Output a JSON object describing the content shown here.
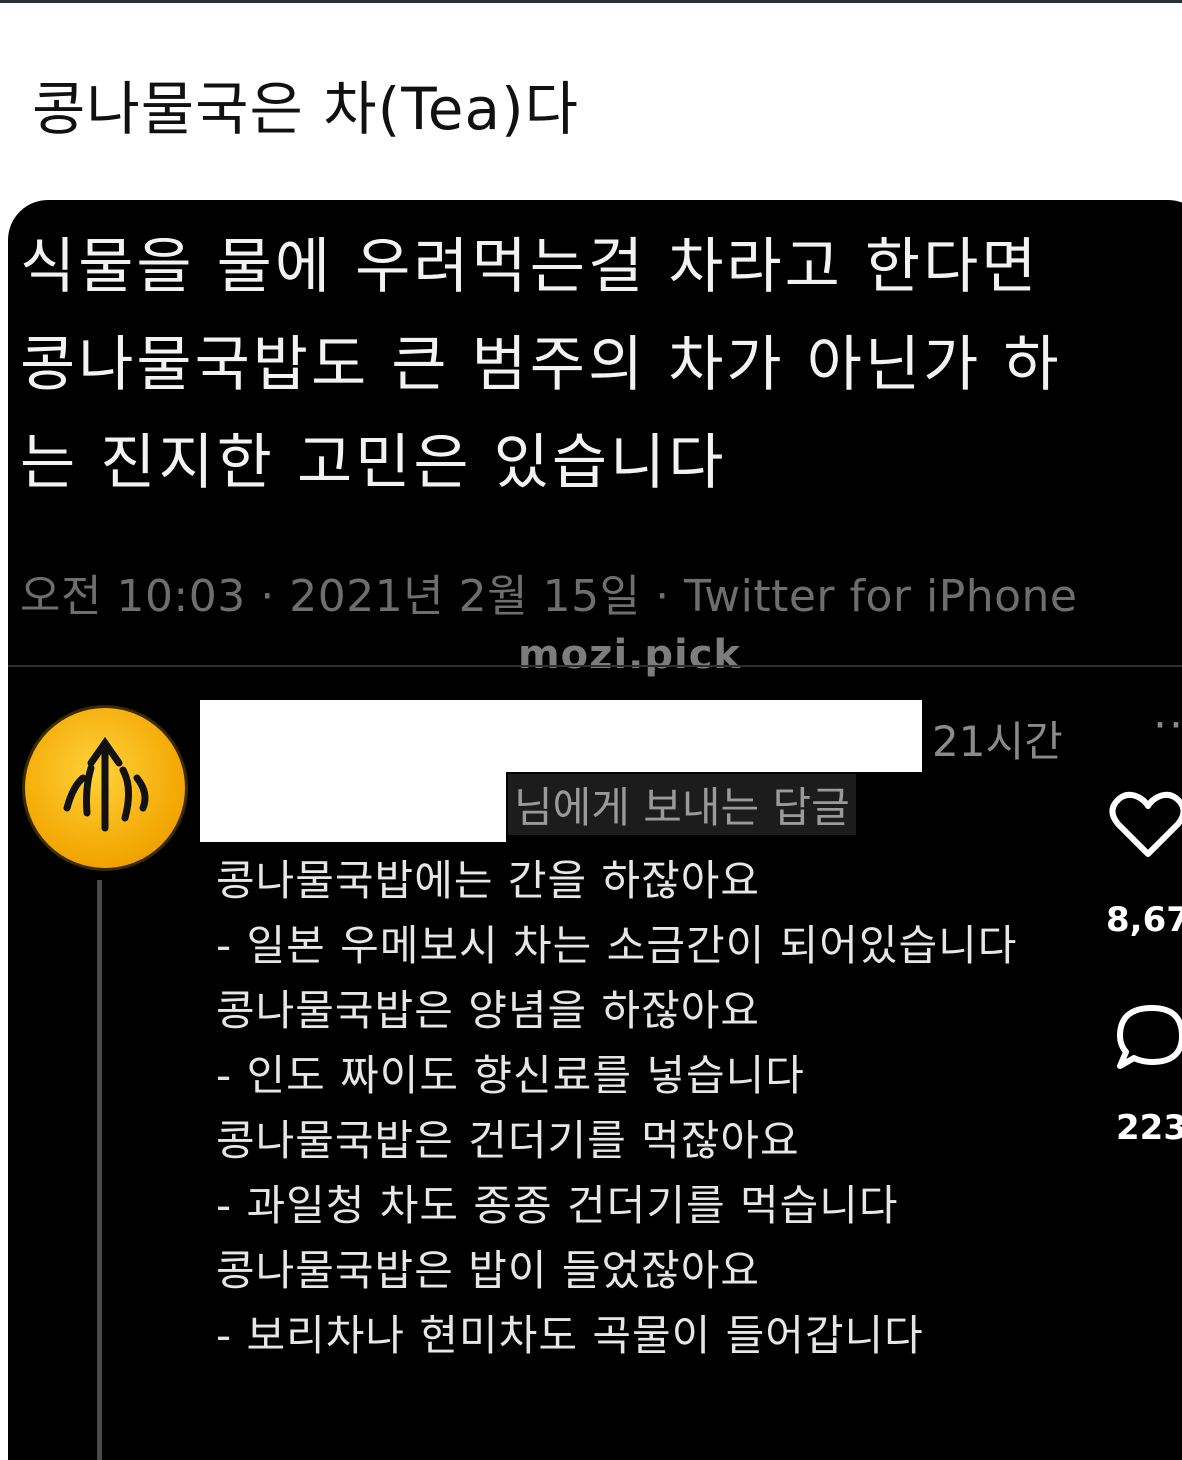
{
  "post": {
    "title": "콩나물국은 차(Tea)다"
  },
  "tweet": {
    "lines": [
      "식물을 물에 우려먹는걸 차라고 한다면",
      "콩나물국밥도 큰 범주의 차가 아닌가 하",
      "는 진지한 고민은 있습니다"
    ],
    "meta": "오전 10:03 · 2021년 2월 15일 · Twitter for iPhone"
  },
  "watermark": "mozi.pick",
  "reply": {
    "time": "21시간",
    "more": "··",
    "to": "님에게 보내는 답글",
    "lines": [
      "콩나물국밥에는 간을 하잖아요",
      "- 일본 우메보시 차는 소금간이 되어있습니다",
      "콩나물국밥은 양념을 하잖아요",
      "- 인도 짜이도 향신료를 넣습니다",
      "콩나물국밥은 건더기를 먹잖아요",
      "- 과일청 차도 종종 건더기를 먹습니다",
      "콩나물국밥은 밥이 들었잖아요",
      "- 보리차나 현미차도 곡물이 들어갑니다"
    ]
  },
  "sidebar": {
    "likes": "8,67",
    "comments": "223",
    "like_icon": "heart-icon",
    "comment_icon": "comment-icon"
  },
  "colors": {
    "background": "#000000",
    "text": "#f2f2f2",
    "meta": "#6e6e6e",
    "avatar": "#f2a500"
  }
}
